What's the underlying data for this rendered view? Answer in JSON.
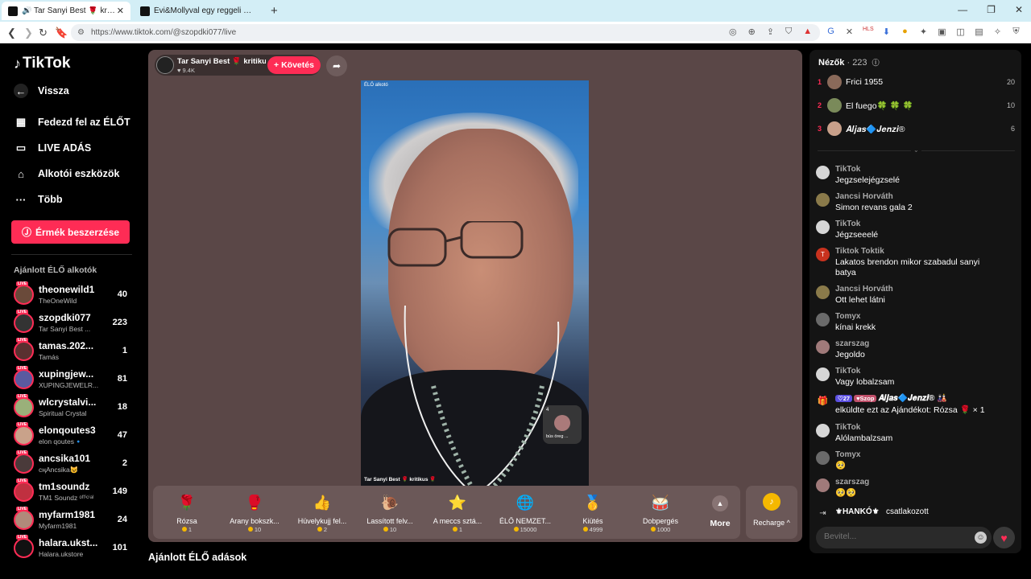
{
  "browser": {
    "tabs": [
      {
        "title": "🔊 Tar Sanyi Best 🌹 kritikus 🌹",
        "active": true
      },
      {
        "title": "Évi&Mollyval egy reggeli 😊😂 (@m",
        "active": false
      }
    ],
    "url": "https://www.tiktok.com/@szopdki077/live"
  },
  "sidebar": {
    "logo": "TikTok",
    "back": "Vissza",
    "nav": [
      {
        "label": "Fedezd fel az ÉLŐT",
        "icon": "calendar-icon"
      },
      {
        "label": "LIVE ADÁS",
        "icon": "video-camera-icon"
      },
      {
        "label": "Alkotói eszközök",
        "icon": "house-icon"
      },
      {
        "label": "Több",
        "icon": "more-dots-icon"
      }
    ],
    "coin_button": "Érmék beszerzése",
    "section_title": "Ajánlott ÉLŐ alkotók",
    "live_badge": "LIVE",
    "creators": [
      {
        "name": "theonewild1",
        "sub": "TheOneWild",
        "count": "40"
      },
      {
        "name": "szopdki077",
        "sub": "Tar Sanyi Best ...",
        "count": "223"
      },
      {
        "name": "tamas.202...",
        "sub": "Tamás",
        "count": "1"
      },
      {
        "name": "xupingjew...",
        "sub": "XUPINGJEWELR...",
        "count": "81"
      },
      {
        "name": "wlcrystalvi...",
        "sub": "Spiritual Crystal",
        "count": "18"
      },
      {
        "name": "elonqoutes3",
        "sub": "elon qoutes🔹",
        "count": "47"
      },
      {
        "name": "ancsika101",
        "sub": "сңAncsika😺",
        "count": "2"
      },
      {
        "name": "tm1soundz",
        "sub": "TM1 Soundz ᵒᶠᶠⁱᶜⁱᵃˡ",
        "count": "149"
      },
      {
        "name": "myfarm1981",
        "sub": "Myfarm1981",
        "count": "24"
      },
      {
        "name": "halara.ukst...",
        "sub": "Halara.ukstore",
        "count": "101"
      }
    ]
  },
  "stage": {
    "host_name": "Tar Sanyi Best 🌹 kritiku...",
    "host_likes": "♥ 9.4K",
    "follow": "+ Követés",
    "video_tag": "ÉLŐ alkotó",
    "video_caption": "Tar Sanyi Best 🌹 kritikus 🌹",
    "mini_count": "4",
    "mini_name": "bús öreg ...",
    "gifts": [
      {
        "name": "Rózsa",
        "price": "1",
        "icon": "🌹"
      },
      {
        "name": "Arany bokszk...",
        "price": "10",
        "icon": "🥊"
      },
      {
        "name": "Hüvelykujj fel...",
        "price": "2",
        "icon": "👍"
      },
      {
        "name": "Lassított felv...",
        "price": "10",
        "icon": "🐌"
      },
      {
        "name": "A meccs sztá...",
        "price": "1",
        "icon": "⭐"
      },
      {
        "name": "ÉLŐ NEMZET...",
        "price": "15000",
        "icon": "🌐"
      },
      {
        "name": "Kiütés",
        "price": "4999",
        "icon": "🥇"
      },
      {
        "name": "Dobpergés",
        "price": "1000",
        "icon": "🥁"
      }
    ],
    "more": "More",
    "recharge": "Recharge ^"
  },
  "below_title": "Ajánlott ÉLŐ adások",
  "chat": {
    "viewers_label": "Nézők",
    "viewers_count": "· 223",
    "top_viewers": [
      {
        "rank": "1",
        "name": "Frici 1955",
        "score": "20"
      },
      {
        "rank": "2",
        "name": "El fuego🍀 🍀 🍀",
        "score": "10"
      },
      {
        "rank": "3",
        "name": "𝑨𝒍𝒋𝒂𝒔🔷𝑱𝒆𝒏𝒛𝒊®",
        "score": "6"
      }
    ],
    "messages": [
      {
        "name": "TikTok",
        "text": "Jegzselejégzselé"
      },
      {
        "name": "Jancsi Horváth",
        "text": "Simon revans gala 2"
      },
      {
        "name": "TikTok",
        "text": "Jégzseeelé"
      },
      {
        "name": "Tiktok Toktik",
        "text": "Lakatos brendon mikor szabadul sanyi batya"
      },
      {
        "name": "Jancsi Horváth",
        "text": "Ott lehet látni"
      },
      {
        "name": "Tomyx",
        "text": "kínai krekk"
      },
      {
        "name": "szarszag",
        "text": "Jegoldo"
      },
      {
        "name": "TikTok",
        "text": "Vagy lobalzsam"
      },
      {
        "name": "𝑨𝒍𝒋𝒂𝒔🔷𝑱𝒆𝒏𝒛𝒊® 🎎",
        "text": "elküldte ezt az Ajándékot: Rózsa 🌹 × 1",
        "badge1": "27",
        "badge2": "Szop"
      },
      {
        "name": "TikTok",
        "text": "Alólambalzsam"
      },
      {
        "name": "Tomyx",
        "text": "🥺"
      },
      {
        "name": "szarszag",
        "text": "🥺🥺"
      }
    ],
    "joined_name": "⚜HANKÓ⚜",
    "joined_text": "csatlakozott",
    "input_placeholder": "Bevitel..."
  },
  "colors": {
    "accent": "#fe2c55",
    "stage_bg": "#5a4747",
    "coin": "#f5b800"
  }
}
